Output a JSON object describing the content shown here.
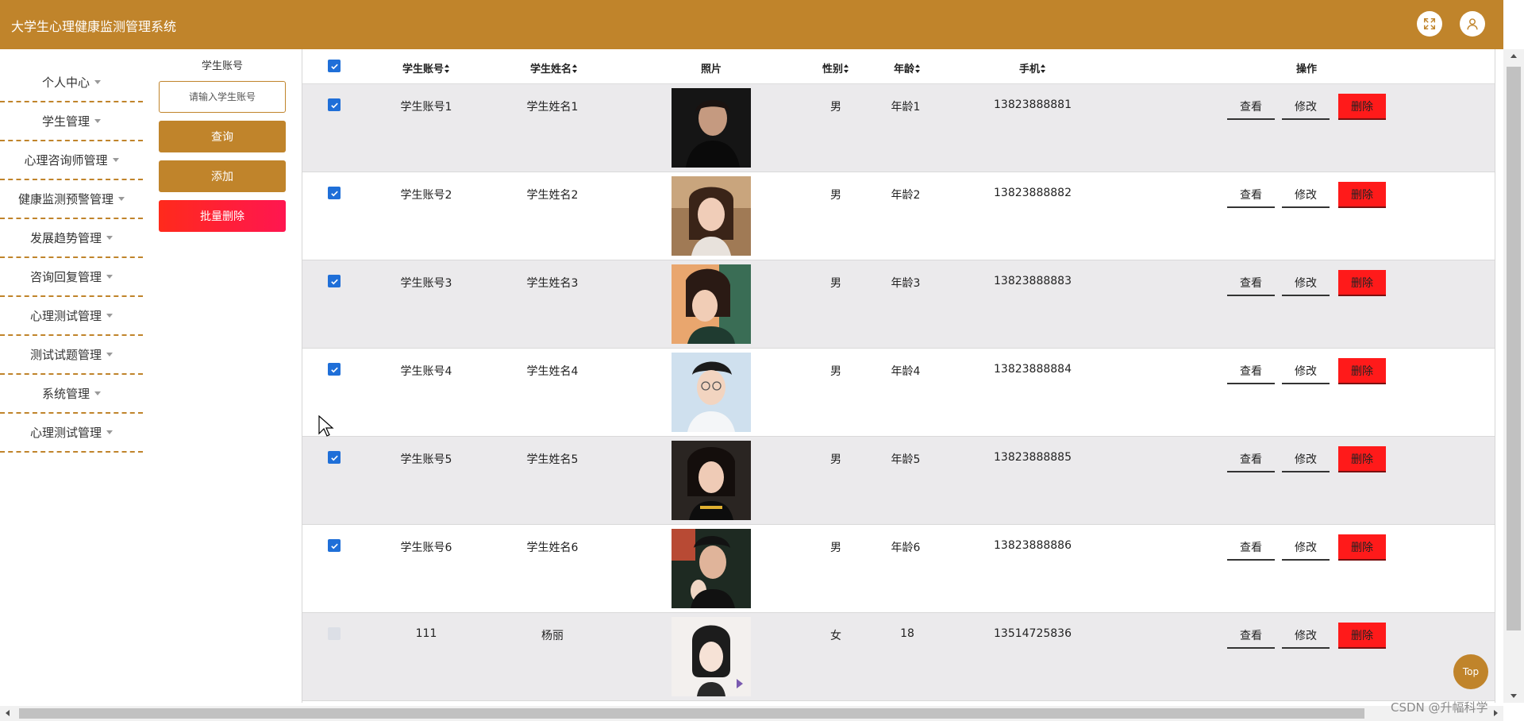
{
  "header": {
    "title": "大学生心理健康监测管理系统",
    "fullscreen_icon": "expand-icon",
    "user_icon": "user-icon"
  },
  "sidebar": {
    "items": [
      {
        "label": "个人中心"
      },
      {
        "label": "学生管理"
      },
      {
        "label": "心理咨询师管理"
      },
      {
        "label": "健康监测预警管理"
      },
      {
        "label": "发展趋势管理"
      },
      {
        "label": "咨询回复管理"
      },
      {
        "label": "心理测试管理"
      },
      {
        "label": "测试试题管理"
      },
      {
        "label": "系统管理"
      },
      {
        "label": "心理测试管理"
      }
    ]
  },
  "search": {
    "label": "学生账号",
    "placeholder": "请输入学生账号",
    "query_label": "查询",
    "add_label": "添加",
    "batch_delete_label": "批量删除"
  },
  "table": {
    "headers": {
      "account": "学生账号",
      "name": "学生姓名",
      "photo": "照片",
      "gender": "性别",
      "age": "年龄",
      "phone": "手机",
      "actions": "操作"
    },
    "action_labels": {
      "view": "查看",
      "edit": "修改",
      "delete": "删除"
    },
    "rows": [
      {
        "checked": true,
        "account": "学生账号1",
        "name": "学生姓名1",
        "gender": "男",
        "age": "年龄1",
        "phone": "13823888881"
      },
      {
        "checked": true,
        "account": "学生账号2",
        "name": "学生姓名2",
        "gender": "男",
        "age": "年龄2",
        "phone": "13823888882"
      },
      {
        "checked": true,
        "account": "学生账号3",
        "name": "学生姓名3",
        "gender": "男",
        "age": "年龄3",
        "phone": "13823888883"
      },
      {
        "checked": true,
        "account": "学生账号4",
        "name": "学生姓名4",
        "gender": "男",
        "age": "年龄4",
        "phone": "13823888884"
      },
      {
        "checked": true,
        "account": "学生账号5",
        "name": "学生姓名5",
        "gender": "男",
        "age": "年龄5",
        "phone": "13823888885"
      },
      {
        "checked": true,
        "account": "学生账号6",
        "name": "学生姓名6",
        "gender": "男",
        "age": "年龄6",
        "phone": "13823888886"
      },
      {
        "checked": false,
        "account": "111",
        "name": "杨丽",
        "gender": "女",
        "age": "18",
        "phone": "13514725836"
      }
    ]
  },
  "top_button": {
    "label": "Top"
  },
  "watermark": "CSDN @升幅科学",
  "colors": {
    "brand": "#c0842b",
    "danger": "#ff1a1a",
    "checkbox": "#1f6fd8"
  }
}
